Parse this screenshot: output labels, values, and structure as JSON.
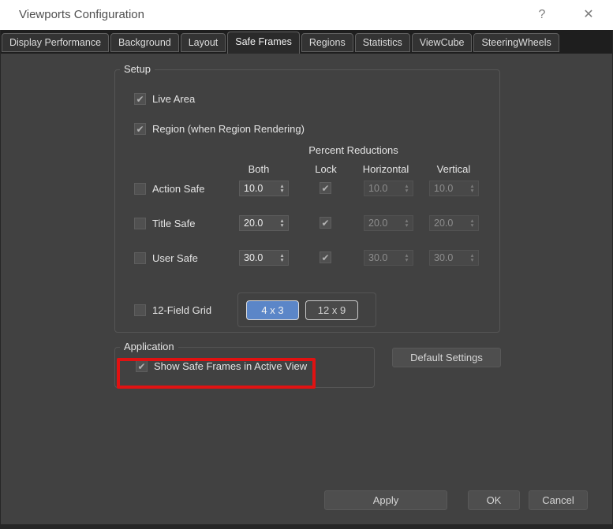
{
  "window": {
    "title": "Viewports Configuration"
  },
  "glyphs": {
    "check": "✔",
    "up": "▴",
    "down": "▾",
    "help": "?",
    "close": "✕"
  },
  "tabs": [
    {
      "label": "Display Performance",
      "active": false
    },
    {
      "label": "Background",
      "active": false
    },
    {
      "label": "Layout",
      "active": false
    },
    {
      "label": "Safe Frames",
      "active": true
    },
    {
      "label": "Regions",
      "active": false
    },
    {
      "label": "Statistics",
      "active": false
    },
    {
      "label": "ViewCube",
      "active": false
    },
    {
      "label": "SteeringWheels",
      "active": false
    }
  ],
  "setup": {
    "legend": "Setup",
    "live_area_label": "Live Area",
    "live_area_checked": true,
    "region_label": "Region (when Region Rendering)",
    "region_checked": true,
    "percent_reductions_label": "Percent Reductions",
    "columns": {
      "both": "Both",
      "lock": "Lock",
      "horizontal": "Horizontal",
      "vertical": "Vertical"
    },
    "rows": [
      {
        "label": "Action Safe",
        "checked": false,
        "both": "10.0",
        "lock_checked": true,
        "horizontal": "10.0",
        "vertical": "10.0"
      },
      {
        "label": "Title Safe",
        "checked": false,
        "both": "20.0",
        "lock_checked": true,
        "horizontal": "20.0",
        "vertical": "20.0"
      },
      {
        "label": "User Safe",
        "checked": false,
        "both": "30.0",
        "lock_checked": true,
        "horizontal": "30.0",
        "vertical": "30.0"
      }
    ],
    "field_grid": {
      "label": "12-Field Grid",
      "checked": false,
      "buttons": [
        {
          "label": "4 x 3",
          "selected": true
        },
        {
          "label": "12 x 9",
          "selected": false
        }
      ]
    }
  },
  "application": {
    "legend": "Application",
    "checkbox_label": "Show Safe Frames in Active View",
    "checked": true
  },
  "buttons": {
    "default_settings": "Default Settings",
    "apply": "Apply",
    "ok": "OK",
    "cancel": "Cancel"
  },
  "colors": {
    "accent_blue": "#5b86c8",
    "annotation_red": "#e01212",
    "titlebar_bg": "#ffffff"
  }
}
